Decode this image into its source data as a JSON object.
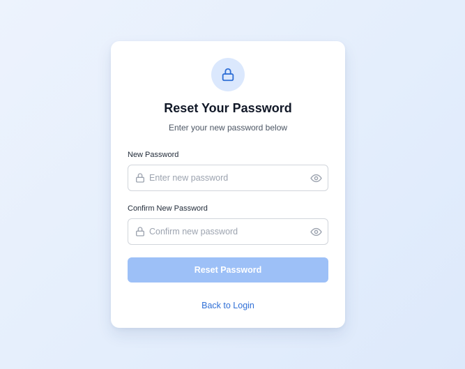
{
  "header": {
    "title": "Reset Your Password",
    "subtitle": "Enter your new password below"
  },
  "form": {
    "new_password": {
      "label": "New Password",
      "placeholder": "Enter new password",
      "value": ""
    },
    "confirm_password": {
      "label": "Confirm New Password",
      "placeholder": "Confirm new password",
      "value": ""
    },
    "submit_label": "Reset Password",
    "back_link_label": "Back to Login"
  },
  "icons": {
    "badge": "lock-icon",
    "field_lead": "lock-icon",
    "field_toggle": "eye-icon"
  },
  "colors": {
    "accent": "#2f6fd6",
    "button_disabled": "#9dc0f7",
    "badge_bg": "#dbe8fd",
    "title": "#111827"
  }
}
